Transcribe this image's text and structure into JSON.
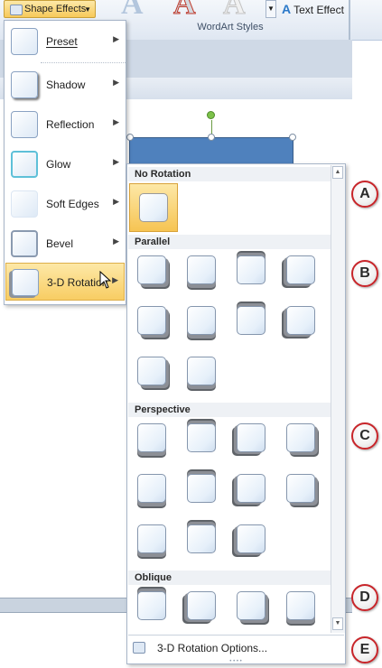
{
  "ribbon": {
    "shape_effects_label": "Shape Effects",
    "wordart_group_label": "WordArt Styles",
    "wordart_letters": [
      "A",
      "A",
      "A"
    ],
    "text_effects_label": "Text Effect"
  },
  "menu": {
    "items": [
      {
        "label": "Preset",
        "accel": "P"
      },
      {
        "label": "Shadow",
        "accel": "S"
      },
      {
        "label": "Reflection",
        "accel": "R"
      },
      {
        "label": "Glow",
        "accel": "G"
      },
      {
        "label": "Soft Edges",
        "accel": "E"
      },
      {
        "label": "Bevel",
        "accel": "B"
      },
      {
        "label": "3-D Rotation",
        "accel": "D",
        "selected": true
      }
    ]
  },
  "gallery": {
    "sections": [
      {
        "title": "No Rotation",
        "count": 1
      },
      {
        "title": "Parallel",
        "count": 10
      },
      {
        "title": "Perspective",
        "count": 11
      },
      {
        "title": "Oblique",
        "count": 4
      }
    ],
    "footer_label": "3-D Rotation Options..."
  },
  "callouts": [
    "A",
    "B",
    "C",
    "D",
    "E"
  ],
  "colors": {
    "accent": "#f7c95a",
    "shape_fill": "#4f81bd",
    "callout_border": "#c8252a"
  }
}
